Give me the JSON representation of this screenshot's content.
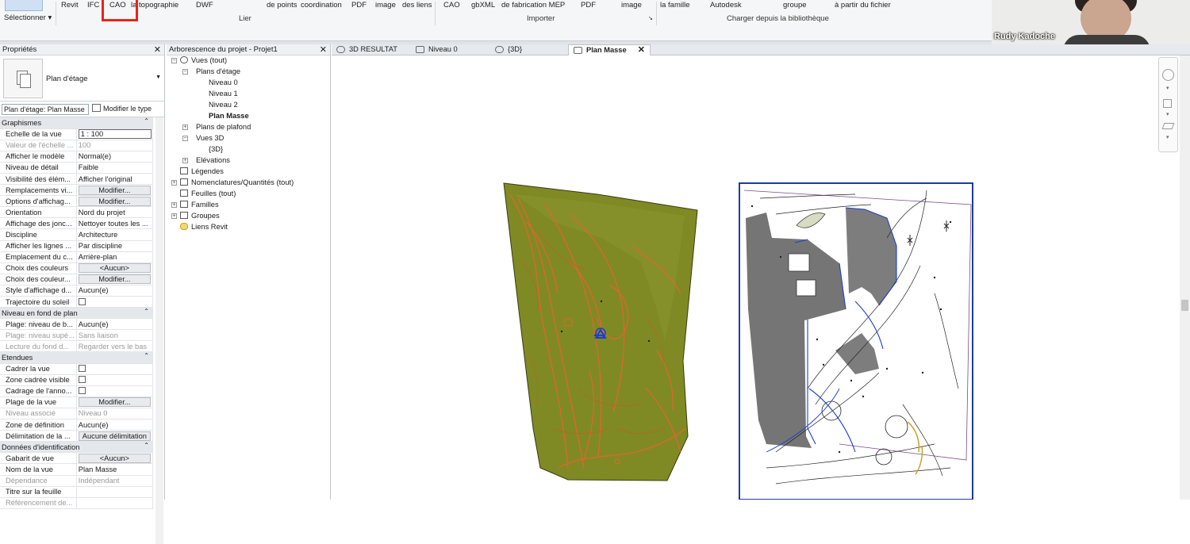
{
  "ribbon": {
    "top_labels": [
      "Revit",
      "IFC",
      "CAO",
      "la topographie",
      "DWF",
      "de points",
      "coordination",
      "PDF",
      "image",
      "des liens",
      "CAO",
      "gbXML",
      "de fabrication MEP",
      "PDF",
      "image",
      "la famille",
      "Autodesk",
      "groupe",
      "à partir du fichier"
    ],
    "select_label": "Sélectionner",
    "groups": {
      "link": "Lier",
      "import": "Importer",
      "library": "Charger depuis la bibliothèque"
    }
  },
  "webcam": {
    "name": "Rudy Kadoche"
  },
  "properties": {
    "title": "Propriétés",
    "type_name": "Plan d'étage",
    "filter": "Plan d'étage: Plan Masse",
    "edit_type": "Modifier le type",
    "sections": [
      {
        "name": "Graphismes",
        "rows": [
          {
            "label": "Echelle de la vue",
            "value": "1 : 100",
            "kind": "input"
          },
          {
            "label": "Valeur de l'échelle ...",
            "value": "100",
            "kind": "disabled"
          },
          {
            "label": "Afficher le modèle",
            "value": "Normal(e)"
          },
          {
            "label": "Niveau de détail",
            "value": "Faible"
          },
          {
            "label": "Visibilité des élém...",
            "value": "Afficher l'original"
          },
          {
            "label": "Remplacements vi...",
            "value": "Modifier...",
            "kind": "button"
          },
          {
            "label": "Options d'affichag...",
            "value": "Modifier...",
            "kind": "button"
          },
          {
            "label": "Orientation",
            "value": "Nord du projet"
          },
          {
            "label": "Affichage des jonc...",
            "value": "Nettoyer toutes les ..."
          },
          {
            "label": "Discipline",
            "value": "Architecture"
          },
          {
            "label": "Afficher les lignes ...",
            "value": "Par discipline"
          },
          {
            "label": "Emplacement du c...",
            "value": "Arrière-plan"
          },
          {
            "label": "Choix des couleurs",
            "value": "<Aucun>",
            "kind": "button"
          },
          {
            "label": "Choix des couleur...",
            "value": "Modifier...",
            "kind": "button"
          },
          {
            "label": "Style d'affichage d...",
            "value": "Aucun(e)"
          },
          {
            "label": "Trajectoire du soleil",
            "value": "",
            "kind": "checkbox"
          }
        ]
      },
      {
        "name": "Niveau en fond de plan",
        "rows": [
          {
            "label": "Plage: niveau de b...",
            "value": "Aucun(e)"
          },
          {
            "label": "Plage: niveau supé...",
            "value": "Sans liaison",
            "kind": "disabled"
          },
          {
            "label": "Lecture du fond d...",
            "value": "Regarder vers le bas",
            "kind": "disabled"
          }
        ]
      },
      {
        "name": "Etendues",
        "rows": [
          {
            "label": "Cadrer la vue",
            "value": "",
            "kind": "checkbox"
          },
          {
            "label": "Zone cadrée visible",
            "value": "",
            "kind": "checkbox"
          },
          {
            "label": "Cadrage de l'anno...",
            "value": "",
            "kind": "checkbox"
          },
          {
            "label": "Plage de la vue",
            "value": "Modifier...",
            "kind": "button"
          },
          {
            "label": "Niveau associé",
            "value": "Niveau 0",
            "kind": "disabled"
          },
          {
            "label": "Zone de définition",
            "value": "Aucun(e)"
          },
          {
            "label": "Délimitation de la ...",
            "value": "Aucune délimitation",
            "kind": "button"
          }
        ]
      },
      {
        "name": "Données d'identification",
        "rows": [
          {
            "label": "Gabarit de vue",
            "value": "<Aucun>",
            "kind": "button"
          },
          {
            "label": "Nom de la vue",
            "value": "Plan Masse"
          },
          {
            "label": "Dépendance",
            "value": "Indépendant",
            "kind": "disabled"
          },
          {
            "label": "Titre sur la feuille",
            "value": ""
          },
          {
            "label": "Référencement de...",
            "value": "",
            "kind": "disabled"
          }
        ]
      }
    ]
  },
  "browser": {
    "title": "Arborescence du projet - Projet1",
    "nodes": {
      "views": "Vues (tout)",
      "floor_plans": "Plans d'étage",
      "n0": "Niveau 0",
      "n1": "Niveau 1",
      "n2": "Niveau 2",
      "masse": "Plan Masse",
      "ceiling": "Plans de plafond",
      "views3d": "Vues 3D",
      "v3d": "{3D}",
      "elev": "Elévations",
      "legends": "Légendes",
      "schedules": "Nomenclatures/Quantités (tout)",
      "sheets": "Feuilles (tout)",
      "families": "Familles",
      "groups": "Groupes",
      "links": "Liens Revit"
    }
  },
  "tabs": [
    {
      "label": "3D RESULTAT",
      "active": false
    },
    {
      "label": "Niveau 0",
      "active": false
    },
    {
      "label": "{3D}",
      "active": false
    },
    {
      "label": "Plan Masse",
      "active": true
    }
  ]
}
